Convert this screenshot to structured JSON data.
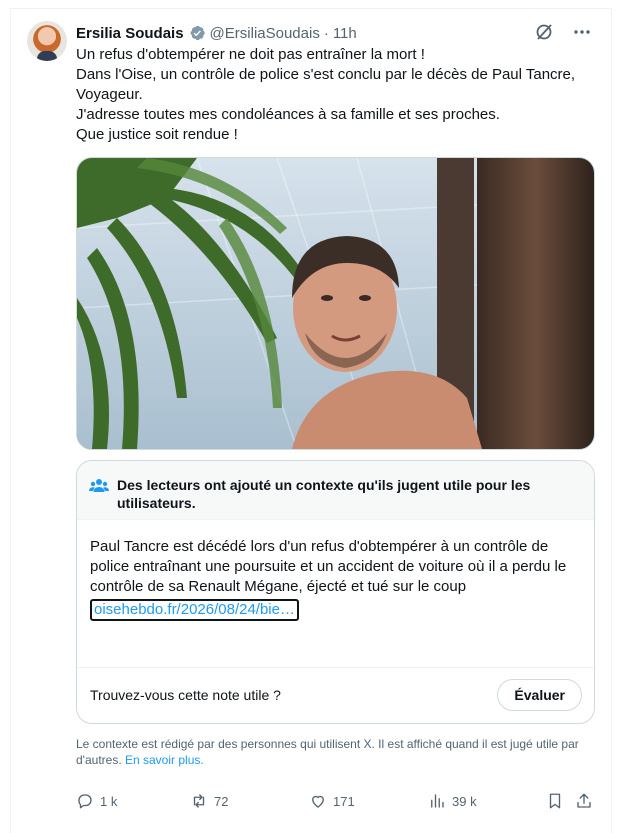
{
  "author": {
    "name": "Ersilia Soudais",
    "handle": "@ErsiliaSoudais",
    "separator": "·",
    "time": "11h"
  },
  "tweet": {
    "lines": [
      "Un refus d'obtempérer ne doit pas entraîner la mort !",
      "Dans l'Oise, un contrôle de police s'est conclu par le décès de Paul Tancre, Voyageur.",
      "J'adresse toutes mes condoléances à sa famille et ses proches.",
      "Que justice soit rendue !"
    ]
  },
  "community_note": {
    "title": "Des lecteurs ont ajouté un contexte qu'ils jugent utile pour les utilisateurs.",
    "body": "Paul Tancre est décédé lors d'un refus d'obtempérer à un contrôle de police entraînant une poursuite et un accident de voiture où il a perdu le contrôle de sa Renault Mégane, éjecté et tué sur le coup",
    "link": "oisehebdo.fr/2026/08/24/bie…",
    "question": "Trouvez-vous cette note utile ?",
    "rate_label": "Évaluer"
  },
  "disclaimer": {
    "text": "Le contexte est rédigé par des personnes qui utilisent X. Il est affiché quand il est jugé utile par d'autres.",
    "more": "En savoir plus."
  },
  "actions": {
    "replies": "1 k",
    "reposts": "72",
    "likes": "171",
    "views": "39 k"
  },
  "colors": {
    "accent": "#1d9bf0",
    "text": "#0f1419",
    "muted": "#536471",
    "border": "#cfd9de"
  },
  "icons": [
    "verified-badge-icon",
    "grok-icon",
    "more-icon",
    "community-people-icon",
    "reply-icon",
    "repost-icon",
    "like-icon",
    "views-icon",
    "bookmark-icon",
    "share-icon"
  ]
}
